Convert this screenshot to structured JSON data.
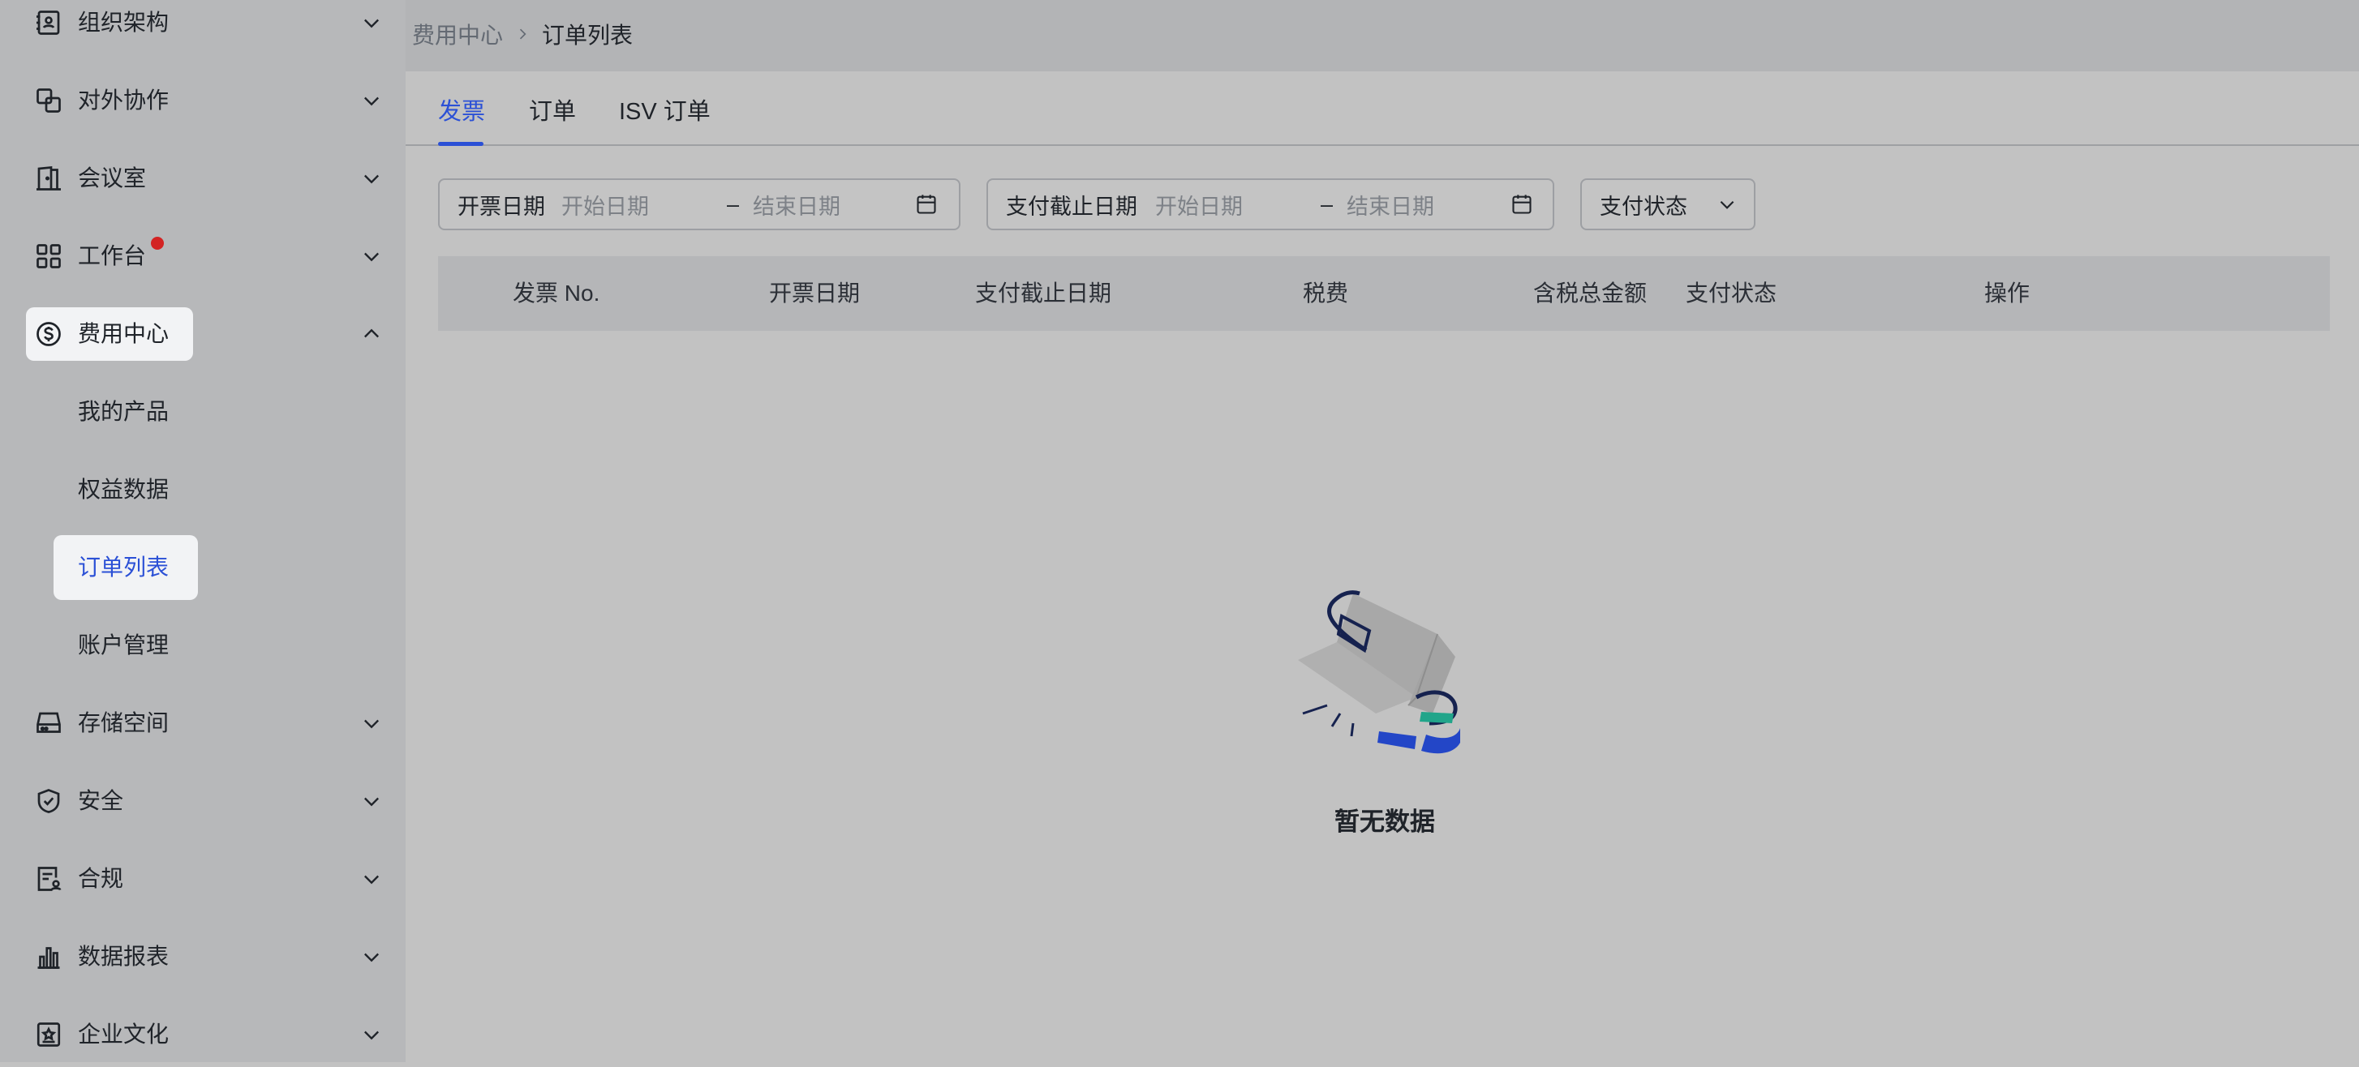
{
  "sidebar": {
    "items": [
      {
        "label": "组织架构",
        "icon": "contacts-book-icon",
        "expanded": false
      },
      {
        "label": "对外协作",
        "icon": "external-collab-icon",
        "expanded": false
      },
      {
        "label": "会议室",
        "icon": "meeting-room-door-icon",
        "expanded": false
      },
      {
        "label": "工作台",
        "icon": "workplace-grid-icon",
        "expanded": false,
        "badge": "red-dot"
      },
      {
        "label": "费用中心",
        "icon": "dollar-circle-icon",
        "expanded": true
      },
      {
        "label": "存储空间",
        "icon": "storage-drive-icon",
        "expanded": false
      },
      {
        "label": "安全",
        "icon": "shield-check-icon",
        "expanded": false
      },
      {
        "label": "合规",
        "icon": "compliance-doc-icon",
        "expanded": false
      },
      {
        "label": "数据报表",
        "icon": "bar-chart-icon",
        "expanded": false
      },
      {
        "label": "企业文化",
        "icon": "culture-star-icon",
        "expanded": false
      }
    ],
    "subitems": [
      {
        "label": "我的产品"
      },
      {
        "label": "权益数据"
      },
      {
        "label": "订单列表",
        "active": true
      },
      {
        "label": "账户管理"
      }
    ]
  },
  "breadcrumb": {
    "parent": "费用中心",
    "current": "订单列表"
  },
  "tabs": [
    {
      "label": "发票",
      "active": true
    },
    {
      "label": "订单"
    },
    {
      "label": "ISV 订单"
    }
  ],
  "filters": {
    "invoice_date": {
      "label": "开票日期",
      "start_placeholder": "开始日期",
      "separator": "–",
      "end_placeholder": "结束日期"
    },
    "due_date": {
      "label": "支付截止日期",
      "start_placeholder": "开始日期",
      "separator": "–",
      "end_placeholder": "结束日期"
    },
    "status": {
      "label": "支付状态"
    }
  },
  "table": {
    "columns": [
      "发票 No.",
      "开票日期",
      "支付截止日期",
      "税费",
      "含税总金额",
      "支付状态",
      "操作"
    ],
    "rows": []
  },
  "empty": {
    "text": "暂无数据"
  },
  "colors": {
    "accent": "#2b50d6",
    "badge": "#d32323",
    "sidebar_bg": "#b7b8ba",
    "content_bg": "#c2c2c2"
  }
}
